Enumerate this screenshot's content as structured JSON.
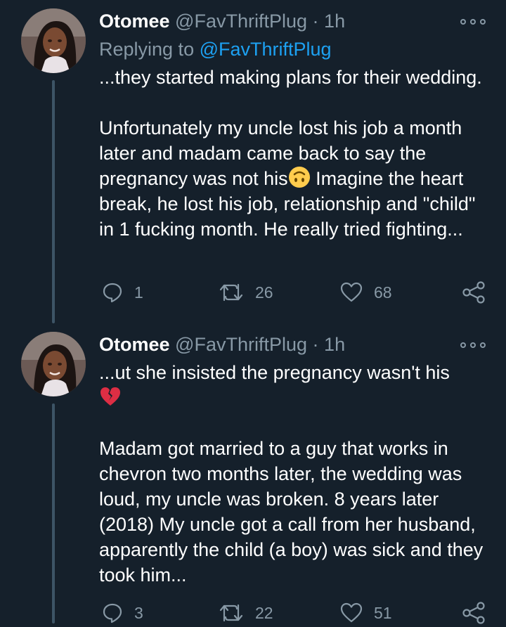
{
  "colors": {
    "background": "#15202b",
    "text_primary": "#ffffff",
    "text_secondary": "#8899a6",
    "link": "#1da1f2",
    "thread_line": "#3d5466"
  },
  "tweets": [
    {
      "author_name": "Otomee",
      "author_handle": "@FavThriftPlug",
      "separator": "·",
      "time": "1h",
      "more_icon": "more-horizontal-icon",
      "replying_label": "Replying to",
      "replying_to": "@FavThriftPlug",
      "paragraphs": [
        {
          "text": "...they started making plans for their wedding."
        },
        {
          "text_before_emoji": "Unfortunately my uncle lost his job a month later and madam came back to say the pregnancy was not his",
          "emoji": "upside-down-face-emoji",
          "text_after_emoji": " Imagine the heart break, he lost his job, relationship and \"child\" in 1 fucking month. He really tried fighting..."
        }
      ],
      "actions": {
        "reply": {
          "icon": "reply-icon",
          "count": "1"
        },
        "retweet": {
          "icon": "retweet-icon",
          "count": "26"
        },
        "like": {
          "icon": "heart-icon",
          "count": "68"
        },
        "share": {
          "icon": "share-icon"
        }
      }
    },
    {
      "author_name": "Otomee",
      "author_handle": "@FavThriftPlug",
      "separator": "·",
      "time": "1h",
      "more_icon": "more-horizontal-icon",
      "paragraphs": [
        {
          "text": "...ut she insisted the pregnancy wasn't his",
          "emoji": "broken-heart-emoji"
        },
        {
          "text": "Madam got married to a guy that works in chevron two months later, the wedding was loud, my uncle was broken. 8 years later (2018) My uncle got a call from her husband, apparently the child (a boy) was sick and they took him..."
        }
      ],
      "actions": {
        "reply": {
          "icon": "reply-icon",
          "count": "3"
        },
        "retweet": {
          "icon": "retweet-icon",
          "count": "22"
        },
        "like": {
          "icon": "heart-icon",
          "count": "51"
        },
        "share": {
          "icon": "share-icon"
        }
      }
    }
  ]
}
